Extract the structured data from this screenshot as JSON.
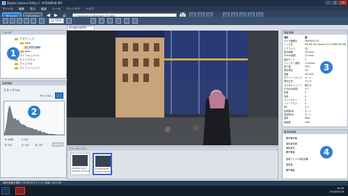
{
  "window": {
    "title": "Digital Camera Utility 5 - K70A8018.PEF"
  },
  "menu": [
    "ファイル",
    "編集",
    "表示",
    "審査",
    "ツール",
    "ウィンドウ",
    "ヘルプ"
  ],
  "toolbar": {
    "browser_label": "Browser",
    "laboratory_label": "Laboratory",
    "path_value": "C:\\Users\\ko-ti\\Desktop\\K70_data",
    "zoom_value": "12.15%"
  },
  "folder_panel": {
    "title": "フォルダ",
    "items": [
      {
        "label": "デスクトップ"
      },
      {
        "label": "data"
      },
      {
        "label": "K70_data"
      },
      {
        "label": "data"
      },
      {
        "label": "マイ ドキュメント"
      },
      {
        "label": "マイ ピクチャ"
      },
      {
        "label": "マイ ビデオ"
      },
      {
        "label": "マイ ミュージック"
      }
    ]
  },
  "histogram": {
    "panel_title": "画像情報",
    "label": "ヒストグラム",
    "channel": "チャンネル",
    "stats": {
      "r1": "R: 4266",
      "r2": "Y: 131",
      "r3": "R: 213",
      "r4": "G: 120",
      "r5": "B: 132"
    }
  },
  "main_tab": {
    "label": "K70A8018.PEF"
  },
  "thumbnails": {
    "panel_title": "ライトボックス",
    "items": [
      {
        "name": "K70A8017.JPG",
        "date": "2016/5/9 16:43:12"
      },
      {
        "name": "K70A8018.PEF",
        "date": "2016/5/9 16:43:12"
      }
    ]
  },
  "exif": {
    "panel_title": "撮影情報",
    "header_key": "項目",
    "header_val": "値",
    "rows": [
      {
        "k": "カメラ機種名",
        "v": "PENTAX K-70"
      },
      {
        "k": "レンズ名",
        "v": "HD DA 18-135mm F3.5-5.6ED DC WR"
      },
      {
        "k": "リアコンバ",
        "v": "なし"
      },
      {
        "k": "焦点距離",
        "v": "18.0mm"
      },
      {
        "k": "35mm換算",
        "v": "27.0mm"
      },
      {
        "k": "露出モード",
        "v": "P"
      },
      {
        "k": "シャッター速度",
        "v": "1/125sec"
      },
      {
        "k": "絞り値",
        "v": "F8.0"
      },
      {
        "k": "露出補正",
        "v": "0.0"
      },
      {
        "k": "感度",
        "v": "ISO 100"
      },
      {
        "k": "ホワイトバランス",
        "v": "オート"
      },
      {
        "k": "測光方式",
        "v": "マルチ"
      },
      {
        "k": "カスタムイメージ",
        "v": "鮮やか"
      },
      {
        "k": "D-Range設定",
        "v": "オフ"
      },
      {
        "k": "彩度",
        "v": "0"
      },
      {
        "k": "色相",
        "v": "0"
      },
      {
        "k": "コントラスト",
        "v": "0"
      },
      {
        "k": "シャープネス",
        "v": "0"
      },
      {
        "k": "NR",
        "v": "オフ"
      },
      {
        "k": "高感度NR",
        "v": "オート"
      },
      {
        "k": "長秒時NR",
        "v": "オート"
      },
      {
        "k": "画質",
        "v": "RAW"
      },
      {
        "k": "画素数",
        "v": "24M"
      }
    ]
  },
  "metadata": {
    "panel_title": "著作権情報",
    "rows": [
      {
        "label": "著作権情報"
      },
      {
        "label": "撮影者情報"
      },
      {
        "label": "撮影者名"
      },
      {
        "label": "著作権者"
      },
      {
        "label": "画像ファイル保証情報"
      },
      {
        "label": "撮影者"
      },
      {
        "label": "著作権者"
      }
    ]
  },
  "status": {
    "text": "1個の画像を選択   112MB   空きディスク容量   136.1GB"
  },
  "taskbar": {
    "time": "16:46",
    "date": "2016/05/16"
  },
  "badges": [
    "1",
    "2",
    "3",
    "4"
  ],
  "colors": {
    "accent": "#2f7fd0",
    "selection": "#3b5fcf"
  }
}
